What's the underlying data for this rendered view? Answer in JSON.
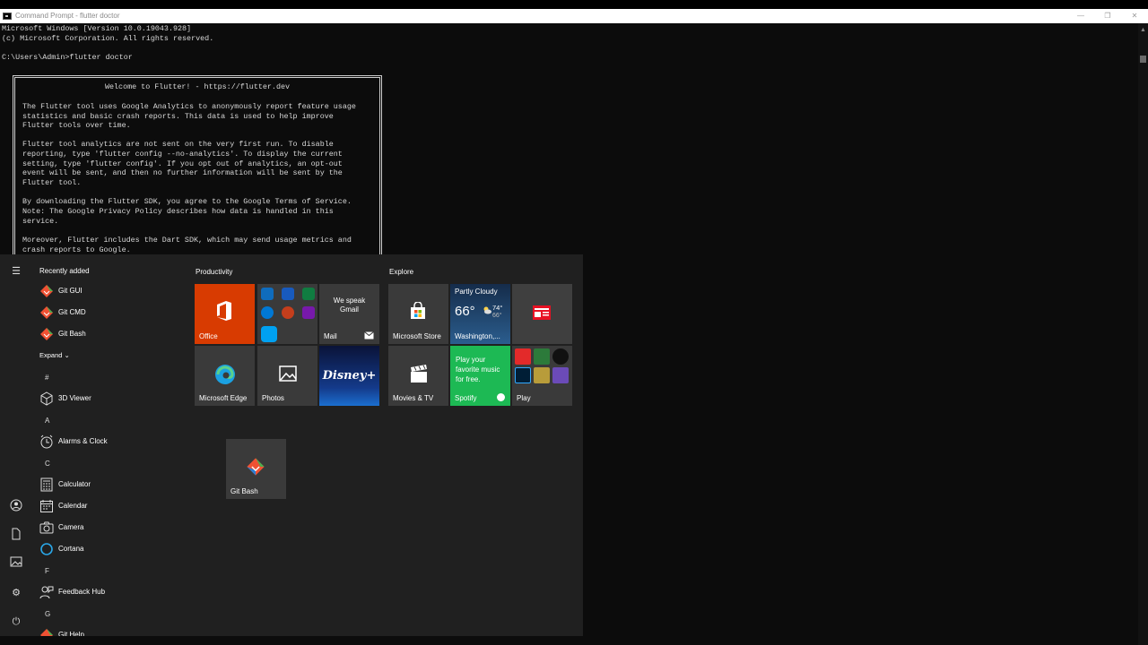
{
  "window": {
    "title": "Command Prompt - flutter  doctor",
    "minimize": "—",
    "maximize": "❐",
    "close": "✕"
  },
  "console": {
    "lines": [
      "Microsoft Windows [Version 10.0.19043.928]",
      "(c) Microsoft Corporation. All rights reserved.",
      "",
      "C:\\Users\\Admin>flutter doctor"
    ],
    "box_title": "Welcome to Flutter! - https://flutter.dev",
    "box_lines": [
      "The Flutter tool uses Google Analytics to anonymously report feature usage",
      "statistics and basic crash reports. This data is used to help improve",
      "Flutter tools over time.",
      "",
      "Flutter tool analytics are not sent on the very first run. To disable",
      "reporting, type 'flutter config --no-analytics'. To display the current",
      "setting, type 'flutter config'. If you opt out of analytics, an opt-out",
      "event will be sent, and then no further information will be sent by the",
      "Flutter tool.",
      "",
      "By downloading the Flutter SDK, you agree to the Google Terms of Service.",
      "Note: The Google Privacy Policy describes how data is handled in this",
      "service.",
      "",
      "Moreover, Flutter includes the Dart SDK, which may send usage metrics and",
      "crash reports to Google."
    ]
  },
  "start": {
    "recently_added": "Recently added",
    "recent": [
      "Git GUI",
      "Git CMD",
      "Git Bash"
    ],
    "expand": "Expand",
    "sections": [
      {
        "letter": "#",
        "apps": [
          "3D Viewer"
        ]
      },
      {
        "letter": "A",
        "apps": [
          "Alarms & Clock"
        ]
      },
      {
        "letter": "C",
        "apps": [
          "Calculator",
          "Calendar",
          "Camera",
          "Cortana"
        ]
      },
      {
        "letter": "F",
        "apps": [
          "Feedback Hub"
        ]
      },
      {
        "letter": "G",
        "apps": [
          "Git Help"
        ]
      }
    ],
    "groups": {
      "productivity": "Productivity",
      "explore": "Explore"
    },
    "tiles": {
      "office": "Office",
      "mail_promo": "We speak Gmail",
      "mail": "Mail",
      "edge": "Microsoft Edge",
      "photos": "Photos",
      "disney": "Disney+",
      "store": "Microsoft Store",
      "weather_cond": "Partly Cloudy",
      "weather_temp": "66°",
      "weather_hi": "74°",
      "weather_lo": "66°",
      "weather_city": "Washington,...",
      "movies": "Movies & TV",
      "spotify_promo": "Play your favorite music for free.",
      "spotify": "Spotify",
      "play": "Play",
      "gitbash": "Git Bash"
    }
  },
  "colors": {
    "office": "#d83b01",
    "spotify": "#1db954",
    "disney": "#0b1d55",
    "weather": "#1a3f66",
    "tile": "#3a3a3a",
    "accent": "#f05133"
  }
}
